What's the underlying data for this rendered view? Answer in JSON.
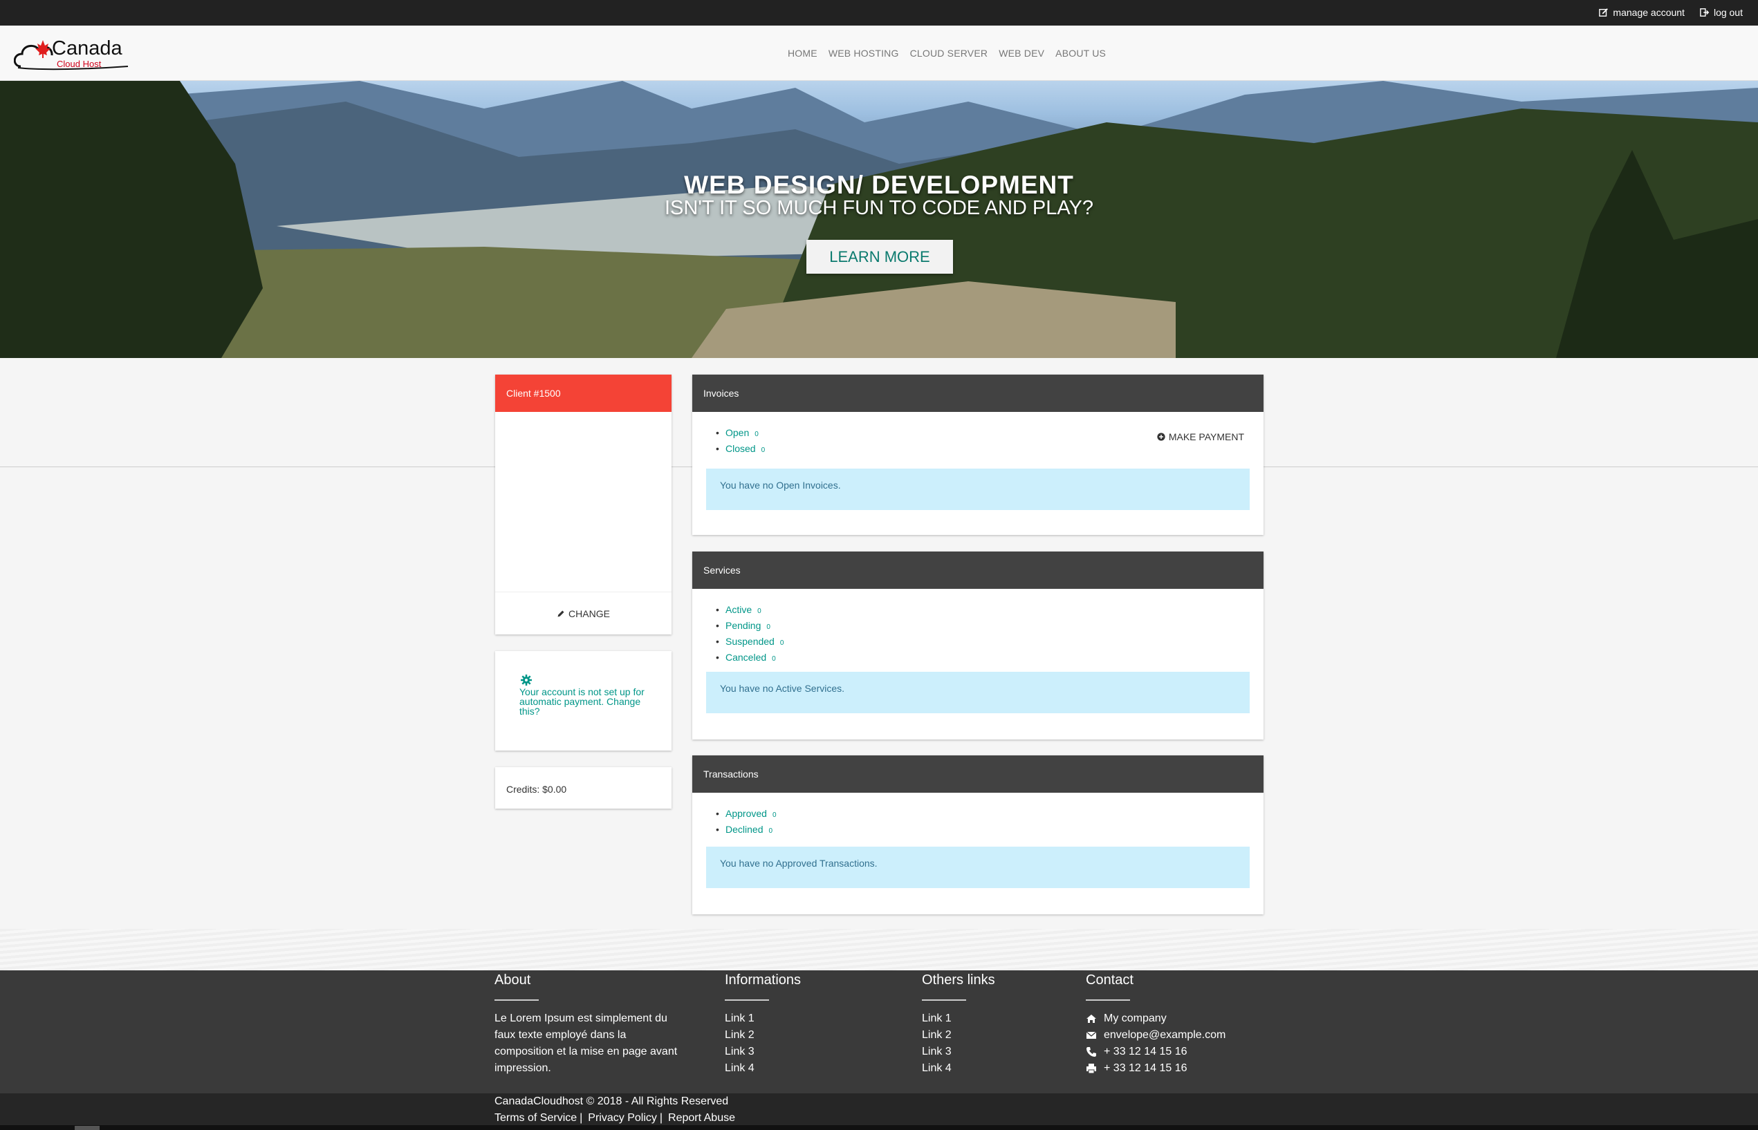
{
  "topbar": {
    "manage_account": "manage account",
    "log_out": "log out"
  },
  "logo": {
    "main": "Canada",
    "sub": "Cloud Host"
  },
  "nav": [
    "HOME",
    "WEB HOSTING",
    "CLOUD SERVER",
    "WEB DEV",
    "ABOUT US"
  ],
  "hero": {
    "title": "WEB DESIGN/ DEVELOPMENT",
    "subtitle": "ISN'T IT SO MUCH FUN TO CODE AND PLAY?",
    "button": "LEARN MORE"
  },
  "client": {
    "title": "Client #1500",
    "change": "CHANGE",
    "auto_payment": "Your account is not set up for automatic payment. Change this?",
    "credits": "Credits: $0.00"
  },
  "invoices": {
    "title": "Invoices",
    "items": [
      {
        "label": "Open",
        "count": "0"
      },
      {
        "label": "Closed",
        "count": "0"
      }
    ],
    "make_payment": "MAKE PAYMENT",
    "empty": "You have no Open Invoices."
  },
  "services": {
    "title": "Services",
    "items": [
      {
        "label": "Active",
        "count": "0"
      },
      {
        "label": "Pending",
        "count": "0"
      },
      {
        "label": "Suspended",
        "count": "0"
      },
      {
        "label": "Canceled",
        "count": "0"
      }
    ],
    "empty": "You have no Active Services."
  },
  "transactions": {
    "title": "Transactions",
    "items": [
      {
        "label": "Approved",
        "count": "0"
      },
      {
        "label": "Declined",
        "count": "0"
      }
    ],
    "empty": "You have no Approved Transactions."
  },
  "footer": {
    "about": {
      "title": "About",
      "text": "Le Lorem Ipsum est simplement du faux texte employé dans la composition et la mise en page avant impression."
    },
    "informations": {
      "title": "Informations",
      "links": [
        "Link 1",
        "Link 2",
        "Link 3",
        "Link 4"
      ]
    },
    "others": {
      "title": "Others links",
      "links": [
        "Link 1",
        "Link 2",
        "Link 3",
        "Link 4"
      ]
    },
    "contact": {
      "title": "Contact",
      "company": "My company",
      "email": "envelope@example.com",
      "phone": "+ 33 12 14 15 16",
      "fax": "+ 33 12 14 15 16"
    },
    "copyright": "CanadaCloudhost © 2018 - All Rights Reserved",
    "bottom_links": [
      "Terms of Service",
      "Privacy Policy",
      "Report Abuse"
    ]
  },
  "colors": {
    "accent": "#009688",
    "client_header": "#f44336",
    "panel_header": "#424242",
    "alert_bg": "#cceffc"
  }
}
